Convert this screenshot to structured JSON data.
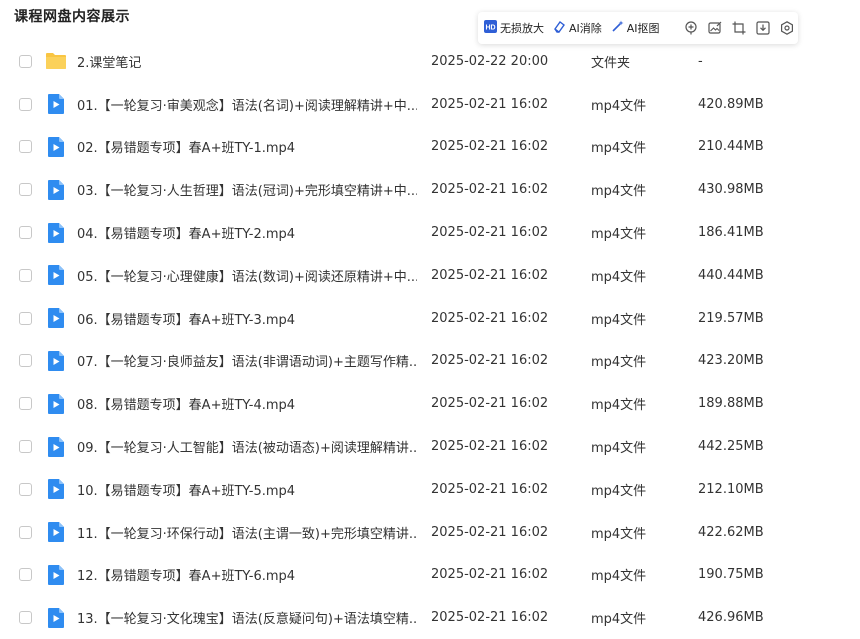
{
  "page": {
    "title": "课程网盘内容展示"
  },
  "toolbar": {
    "buttons": [
      {
        "label": "无损放大",
        "icon": "hd-upscale-icon"
      },
      {
        "label": "AI消除",
        "icon": "eraser-icon"
      },
      {
        "label": "AI抠图",
        "icon": "magic-wand-icon"
      }
    ],
    "icons": [
      "pin-icon",
      "image-edit-icon",
      "crop-icon",
      "download-icon",
      "settings-icon"
    ]
  },
  "files": [
    {
      "name": "2.课堂笔记",
      "date": "2025-02-22 20:00",
      "type": "文件夹",
      "size": "-",
      "icon": "folder-icon"
    },
    {
      "name": "01.【一轮复习·审美观念】语法(名词)+阅读理解精讲+中...",
      "date": "2025-02-21 16:02",
      "type": "mp4文件",
      "size": "420.89MB",
      "icon": "video-file-icon"
    },
    {
      "name": "02.【易错题专项】春A+班TY-1.mp4",
      "date": "2025-02-21 16:02",
      "type": "mp4文件",
      "size": "210.44MB",
      "icon": "video-file-icon"
    },
    {
      "name": "03.【一轮复习·人生哲理】语法(冠词)+完形填空精讲+中...",
      "date": "2025-02-21 16:02",
      "type": "mp4文件",
      "size": "430.98MB",
      "icon": "video-file-icon"
    },
    {
      "name": "04.【易错题专项】春A+班TY-2.mp4",
      "date": "2025-02-21 16:02",
      "type": "mp4文件",
      "size": "186.41MB",
      "icon": "video-file-icon"
    },
    {
      "name": "05.【一轮复习·心理健康】语法(数词)+阅读还原精讲+中...",
      "date": "2025-02-21 16:02",
      "type": "mp4文件",
      "size": "440.44MB",
      "icon": "video-file-icon"
    },
    {
      "name": "06.【易错题专项】春A+班TY-3.mp4",
      "date": "2025-02-21 16:02",
      "type": "mp4文件",
      "size": "219.57MB",
      "icon": "video-file-icon"
    },
    {
      "name": "07.【一轮复习·良师益友】语法(非谓语动词)+主题写作精...",
      "date": "2025-02-21 16:02",
      "type": "mp4文件",
      "size": "423.20MB",
      "icon": "video-file-icon"
    },
    {
      "name": "08.【易错题专项】春A+班TY-4.mp4",
      "date": "2025-02-21 16:02",
      "type": "mp4文件",
      "size": "189.88MB",
      "icon": "video-file-icon"
    },
    {
      "name": "09.【一轮复习·人工智能】语法(被动语态)+阅读理解精讲...",
      "date": "2025-02-21 16:02",
      "type": "mp4文件",
      "size": "442.25MB",
      "icon": "video-file-icon"
    },
    {
      "name": "10.【易错题专项】春A+班TY-5.mp4",
      "date": "2025-02-21 16:02",
      "type": "mp4文件",
      "size": "212.10MB",
      "icon": "video-file-icon"
    },
    {
      "name": "11.【一轮复习·环保行动】语法(主谓一致)+完形填空精讲...",
      "date": "2025-02-21 16:02",
      "type": "mp4文件",
      "size": "422.62MB",
      "icon": "video-file-icon"
    },
    {
      "name": "12.【易错题专项】春A+班TY-6.mp4",
      "date": "2025-02-21 16:02",
      "type": "mp4文件",
      "size": "190.75MB",
      "icon": "video-file-icon"
    },
    {
      "name": "13.【一轮复习·文化瑰宝】语法(反意疑问句)+语法填空精...",
      "date": "2025-02-21 16:02",
      "type": "mp4文件",
      "size": "426.96MB",
      "icon": "video-file-icon"
    }
  ],
  "colors": {
    "video_icon": "#2f8cf0",
    "folder_icon": "#f9c542",
    "text": "#333333"
  }
}
